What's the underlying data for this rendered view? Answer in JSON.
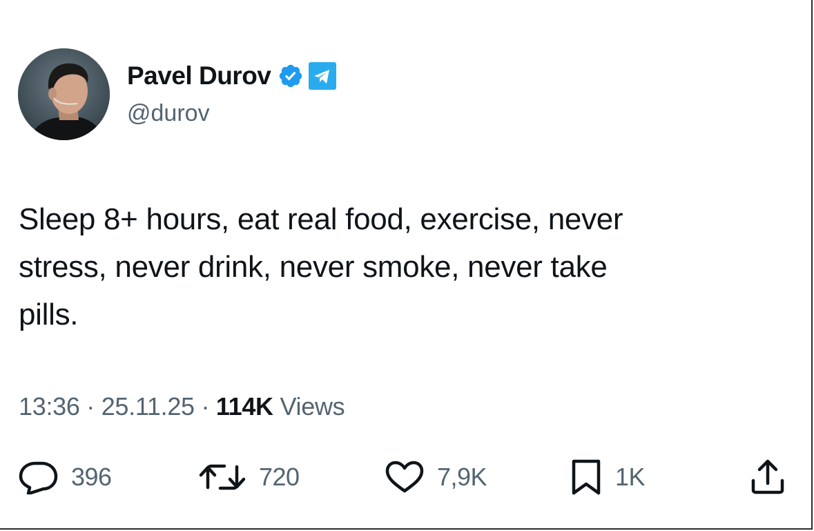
{
  "author": {
    "display_name": "Pavel Durov",
    "handle": "@durov",
    "avatar_icon": "profile-photo",
    "verified_icon": "verified-badge-icon",
    "affiliation_icon": "telegram-icon"
  },
  "tweet": {
    "text": "Sleep 8+ hours, eat real food, exercise, never\nstress, never drink, never smoke, never take\npills."
  },
  "meta": {
    "time": "13:36",
    "separator": "·",
    "date": "25.11.25",
    "views_count": "114K",
    "views_label": "Views"
  },
  "actions": {
    "reply": {
      "icon": "reply-icon",
      "count": "396"
    },
    "retweet": {
      "icon": "retweet-icon",
      "count": "720"
    },
    "like": {
      "icon": "heart-icon",
      "count": "7,9K"
    },
    "bookmark": {
      "icon": "bookmark-icon",
      "count": "1K"
    },
    "share": {
      "icon": "share-icon"
    }
  },
  "colors": {
    "text_primary": "#0f1419",
    "text_secondary": "#536471",
    "verified_blue": "#1d9bf0",
    "telegram_blue": "#2aabee"
  }
}
